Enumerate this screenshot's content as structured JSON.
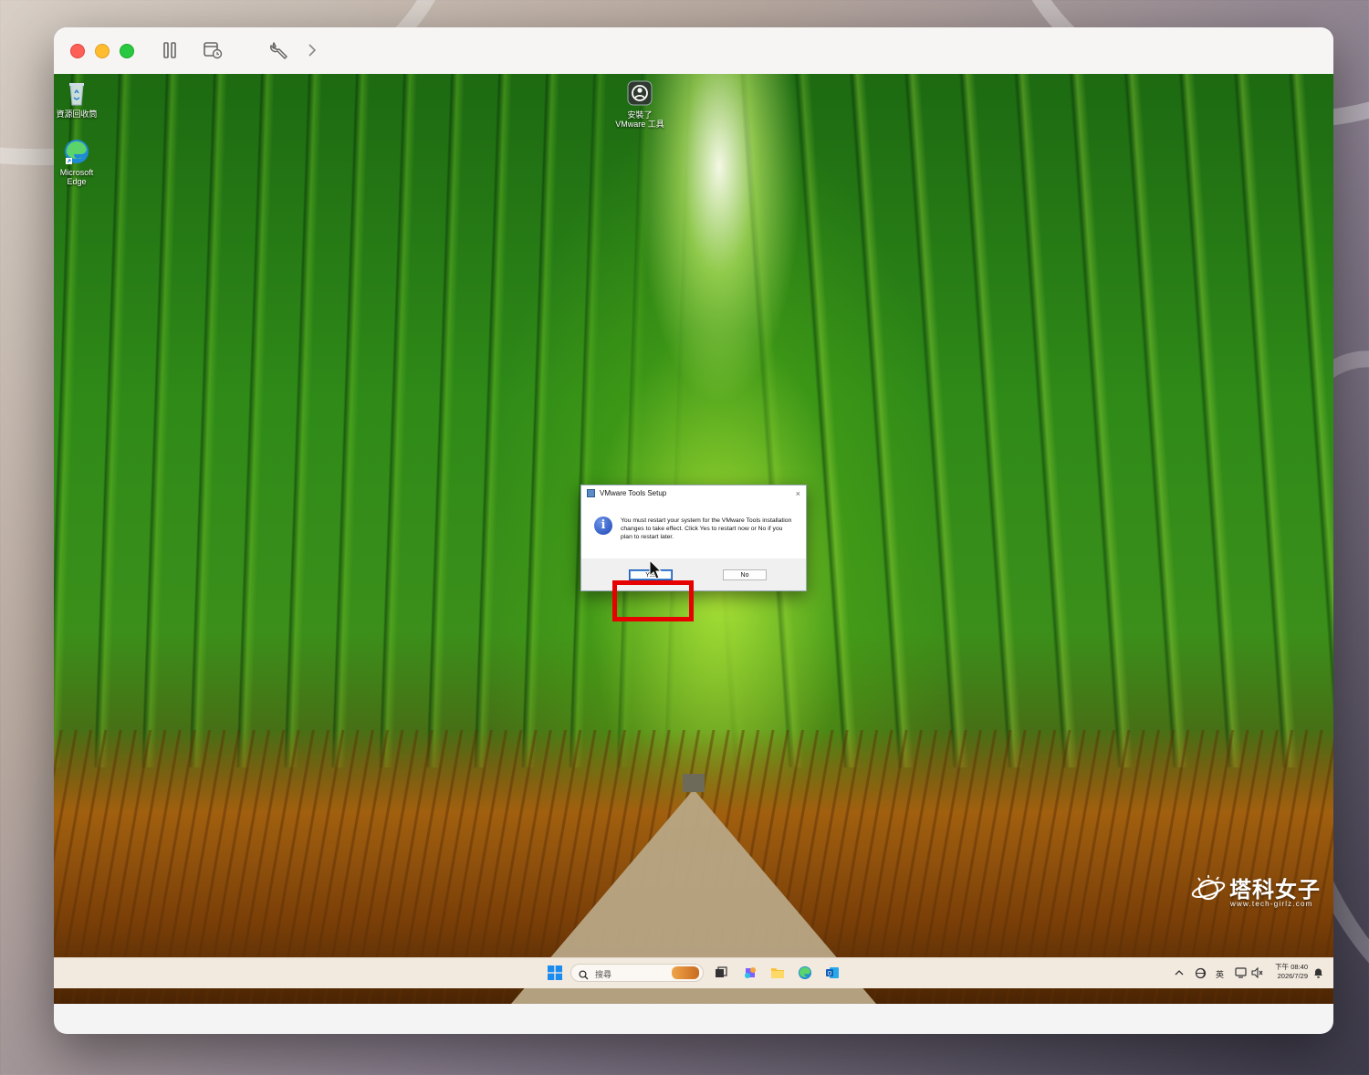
{
  "desktop": {
    "icons": [
      {
        "label": "資源回收筒",
        "icon": "recycle-bin-icon"
      },
      {
        "label": "Microsoft Edge",
        "icon": "edge-icon"
      },
      {
        "label": "安裝了 VMware 工具",
        "icon": "vmware-tools-shortcut-icon"
      }
    ]
  },
  "dialog": {
    "title": "VMware Tools Setup",
    "message": "You must restart your system for the VMware Tools installation changes to take effect. Click Yes to restart now or No if you plan to restart later.",
    "yes_label": "Yes",
    "no_label": "No",
    "close_glyph": "×",
    "info_glyph": "i"
  },
  "taskbar": {
    "search_placeholder": "搜尋",
    "language": "英",
    "time": "下午 08:40",
    "date": "2026/7/29"
  },
  "watermark": {
    "title": "塔科女子",
    "subtitle": "www.tech-girlz.com"
  },
  "colors": {
    "highlight": "#e60000",
    "mac_red": "#fe5f57",
    "mac_yellow": "#febc2e",
    "mac_green": "#28c840"
  }
}
